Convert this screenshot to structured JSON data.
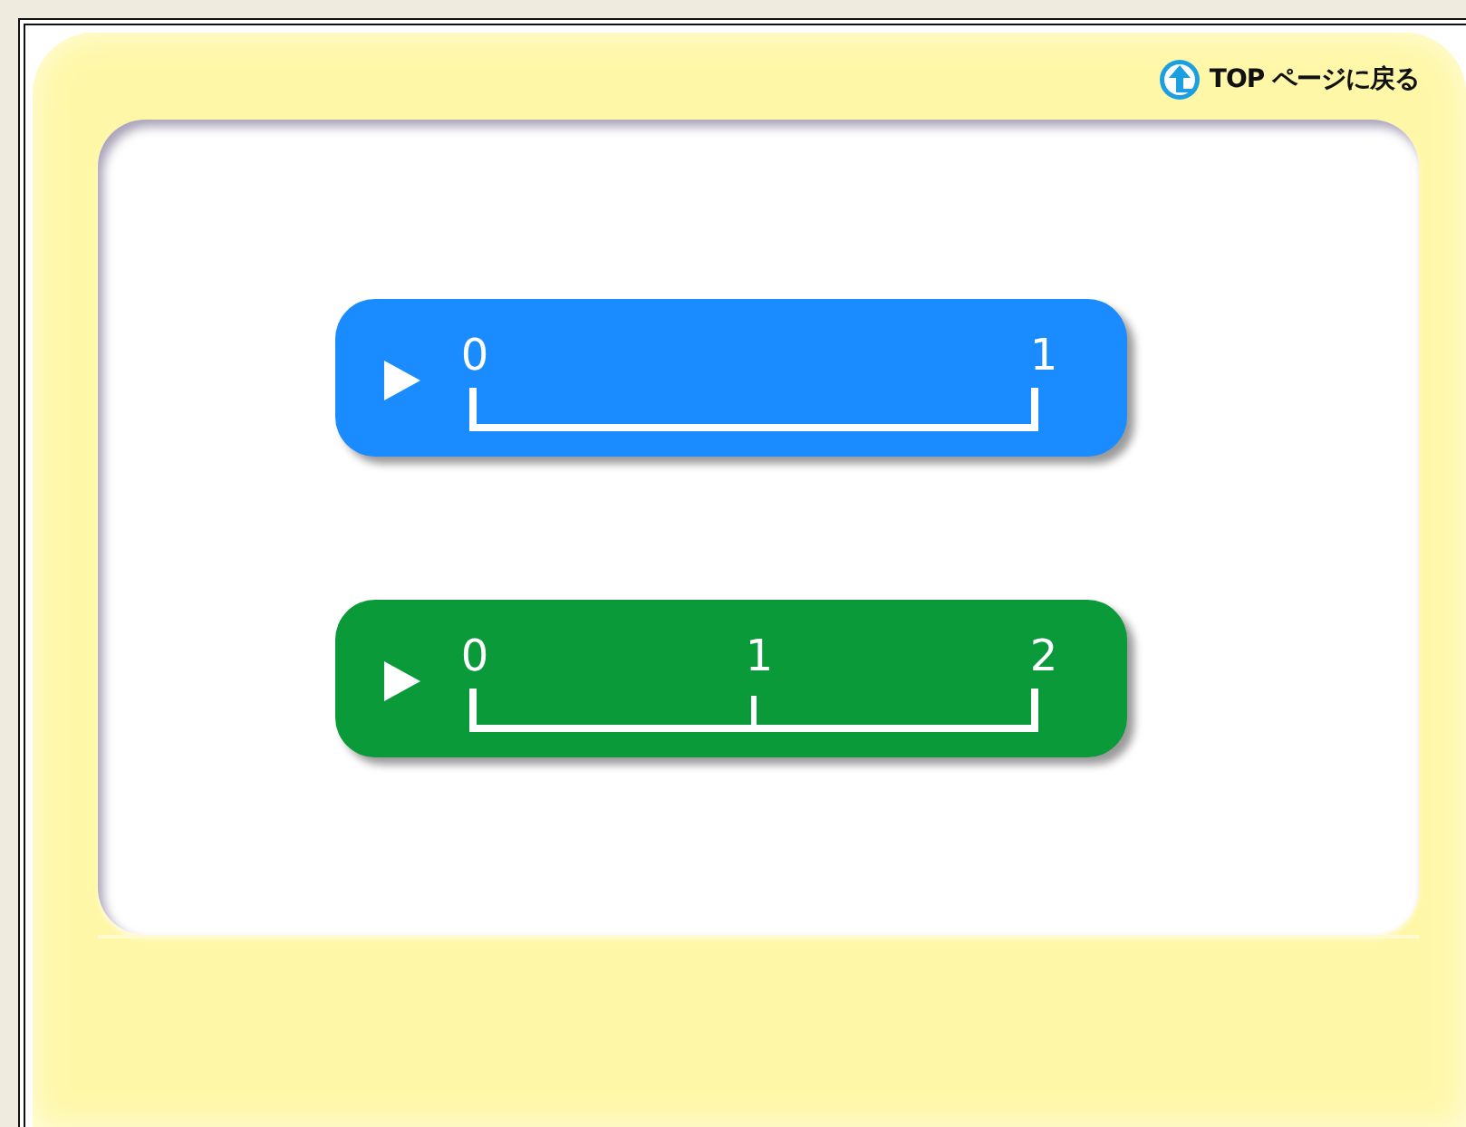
{
  "top_link": {
    "label": "TOP ページに戻る"
  },
  "number_lines": [
    {
      "color": "#1a8cff",
      "ticks": [
        "0",
        "1"
      ]
    },
    {
      "color": "#0a9a3a",
      "ticks": [
        "0",
        "1",
        "2"
      ]
    }
  ]
}
